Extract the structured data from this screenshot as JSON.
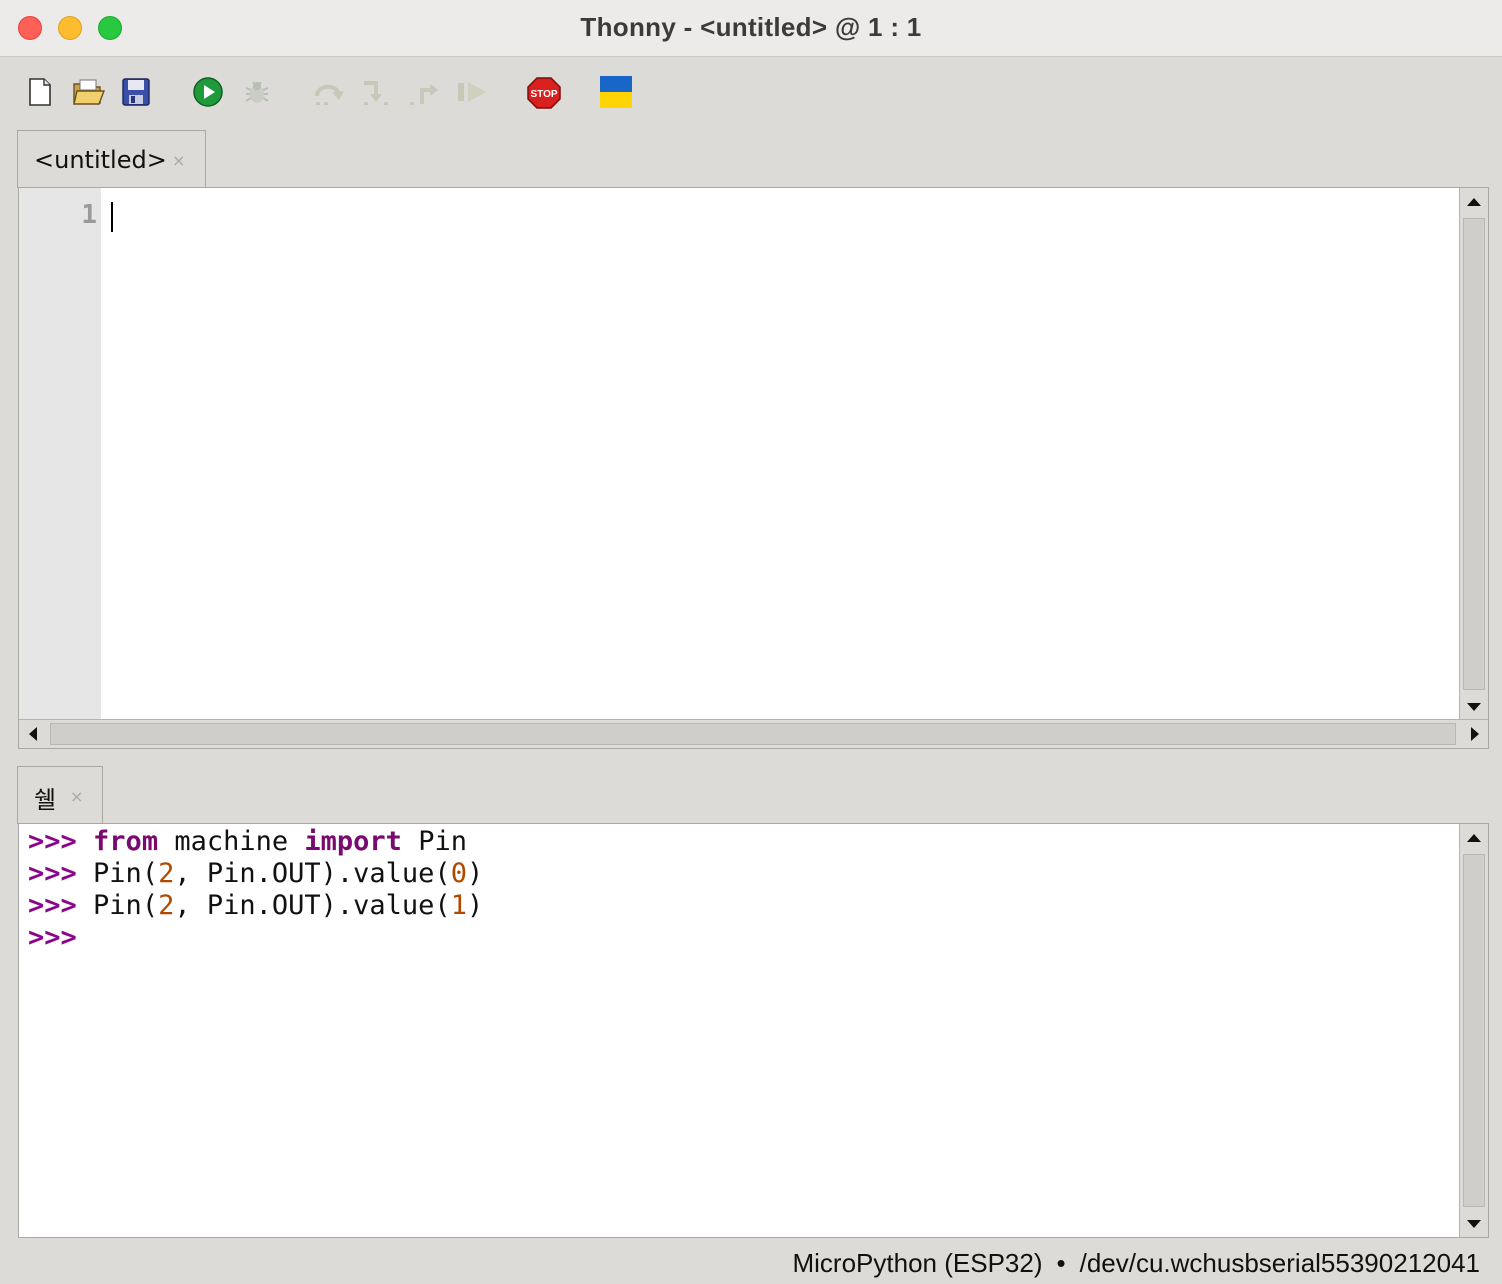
{
  "window": {
    "title": "Thonny  -  <untitled>  @  1 : 1"
  },
  "toolbar": {
    "buttons": [
      {
        "name": "new-file",
        "icon": "new-file-icon"
      },
      {
        "name": "open-file",
        "icon": "folder-open-icon"
      },
      {
        "name": "save-file",
        "icon": "floppy-disk-icon"
      },
      {
        "name": "run",
        "icon": "play-icon"
      },
      {
        "name": "debug",
        "icon": "bug-icon"
      },
      {
        "name": "step-over",
        "icon": "step-over-icon"
      },
      {
        "name": "step-into",
        "icon": "step-into-icon"
      },
      {
        "name": "step-out",
        "icon": "step-out-icon"
      },
      {
        "name": "resume",
        "icon": "resume-icon"
      },
      {
        "name": "stop",
        "icon": "stop-sign-icon",
        "label": "STOP"
      },
      {
        "name": "ukraine-support",
        "icon": "ukraine-flag-icon"
      }
    ]
  },
  "editor": {
    "tab_label": "<untitled>",
    "tab_close": "×",
    "line_numbers": [
      "1"
    ]
  },
  "shell": {
    "tab_label": "쉘",
    "tab_close": "×",
    "lines": [
      {
        "prompt": ">>>",
        "parts": [
          {
            "t": "from",
            "c": "kw"
          },
          {
            "t": " machine ",
            "c": ""
          },
          {
            "t": "import",
            "c": "kw"
          },
          {
            "t": " Pin",
            "c": ""
          }
        ]
      },
      {
        "prompt": ">>>",
        "parts": [
          {
            "t": "Pin(",
            "c": ""
          },
          {
            "t": "2",
            "c": "num"
          },
          {
            "t": ", Pin.OUT).value(",
            "c": ""
          },
          {
            "t": "0",
            "c": "num"
          },
          {
            "t": ")",
            "c": ""
          }
        ]
      },
      {
        "prompt": ">>>",
        "parts": [
          {
            "t": "Pin(",
            "c": ""
          },
          {
            "t": "2",
            "c": "num"
          },
          {
            "t": ", Pin.OUT).value(",
            "c": ""
          },
          {
            "t": "1",
            "c": "num"
          },
          {
            "t": ")",
            "c": ""
          }
        ]
      },
      {
        "prompt": ">>>",
        "parts": []
      }
    ]
  },
  "status": {
    "interpreter": "MicroPython (ESP32)",
    "separator": "•",
    "port": "/dev/cu.wchusbserial55390212041"
  },
  "colors": {
    "prompt": "#8a068a",
    "keyword": "#7a0a70",
    "number": "#b04a00"
  }
}
